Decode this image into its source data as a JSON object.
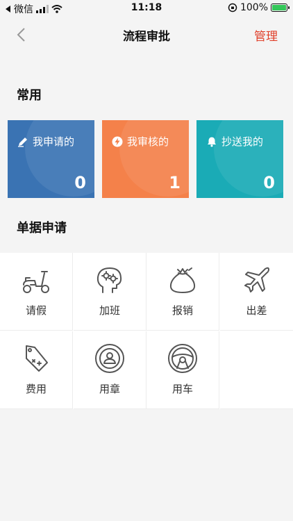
{
  "status_bar": {
    "carrier": "微信",
    "time": "11:18",
    "battery": "100%"
  },
  "nav": {
    "title": "流程审批",
    "manage_label": "管理"
  },
  "sections": {
    "common_title": "常用",
    "apply_title": "单据申请"
  },
  "cards": [
    {
      "label": "我申请的",
      "count": "0",
      "color": "#3a73b3",
      "icon": "pencil-icon"
    },
    {
      "label": "我审核的",
      "count": "1",
      "color": "#f4814a",
      "icon": "lightning-icon"
    },
    {
      "label": "抄送我的",
      "count": "0",
      "color": "#1aabb6",
      "icon": "bell-icon"
    }
  ],
  "applications": [
    {
      "label": "请假",
      "icon": "scooter-icon"
    },
    {
      "label": "加班",
      "icon": "brain-gears-icon"
    },
    {
      "label": "报销",
      "icon": "money-bag-icon"
    },
    {
      "label": "出差",
      "icon": "airplane-icon"
    },
    {
      "label": "费用",
      "icon": "price-tag-icon"
    },
    {
      "label": "用章",
      "icon": "user-seal-icon"
    },
    {
      "label": "用车",
      "icon": "steering-wheel-icon"
    }
  ]
}
